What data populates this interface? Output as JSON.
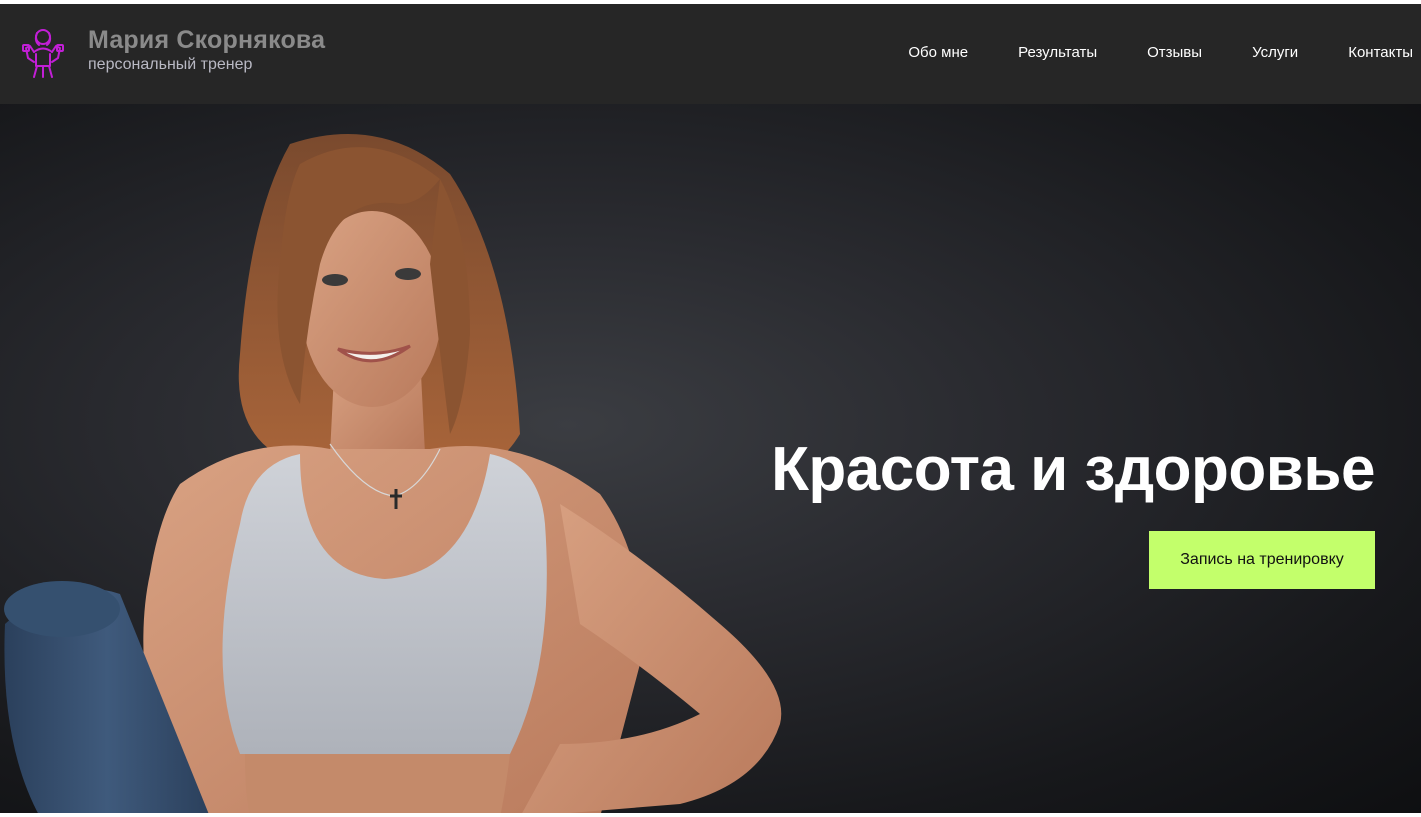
{
  "header": {
    "logo_icon": "trainer-icon",
    "brand_name": "Мария Скорнякова",
    "brand_subtitle": "персональный тренер"
  },
  "nav": {
    "items": [
      {
        "label": "Обо мне"
      },
      {
        "label": "Результаты"
      },
      {
        "label": "Отзывы"
      },
      {
        "label": "Услуги"
      },
      {
        "label": "Контакты"
      }
    ]
  },
  "hero": {
    "title": "Красота и здоровье",
    "cta_label": "Запись на тренировку",
    "photo": "woman-with-yoga-mat"
  },
  "colors": {
    "header_bg": "#262626",
    "accent": "#c3ff6b",
    "logo": "#c21fd6"
  }
}
